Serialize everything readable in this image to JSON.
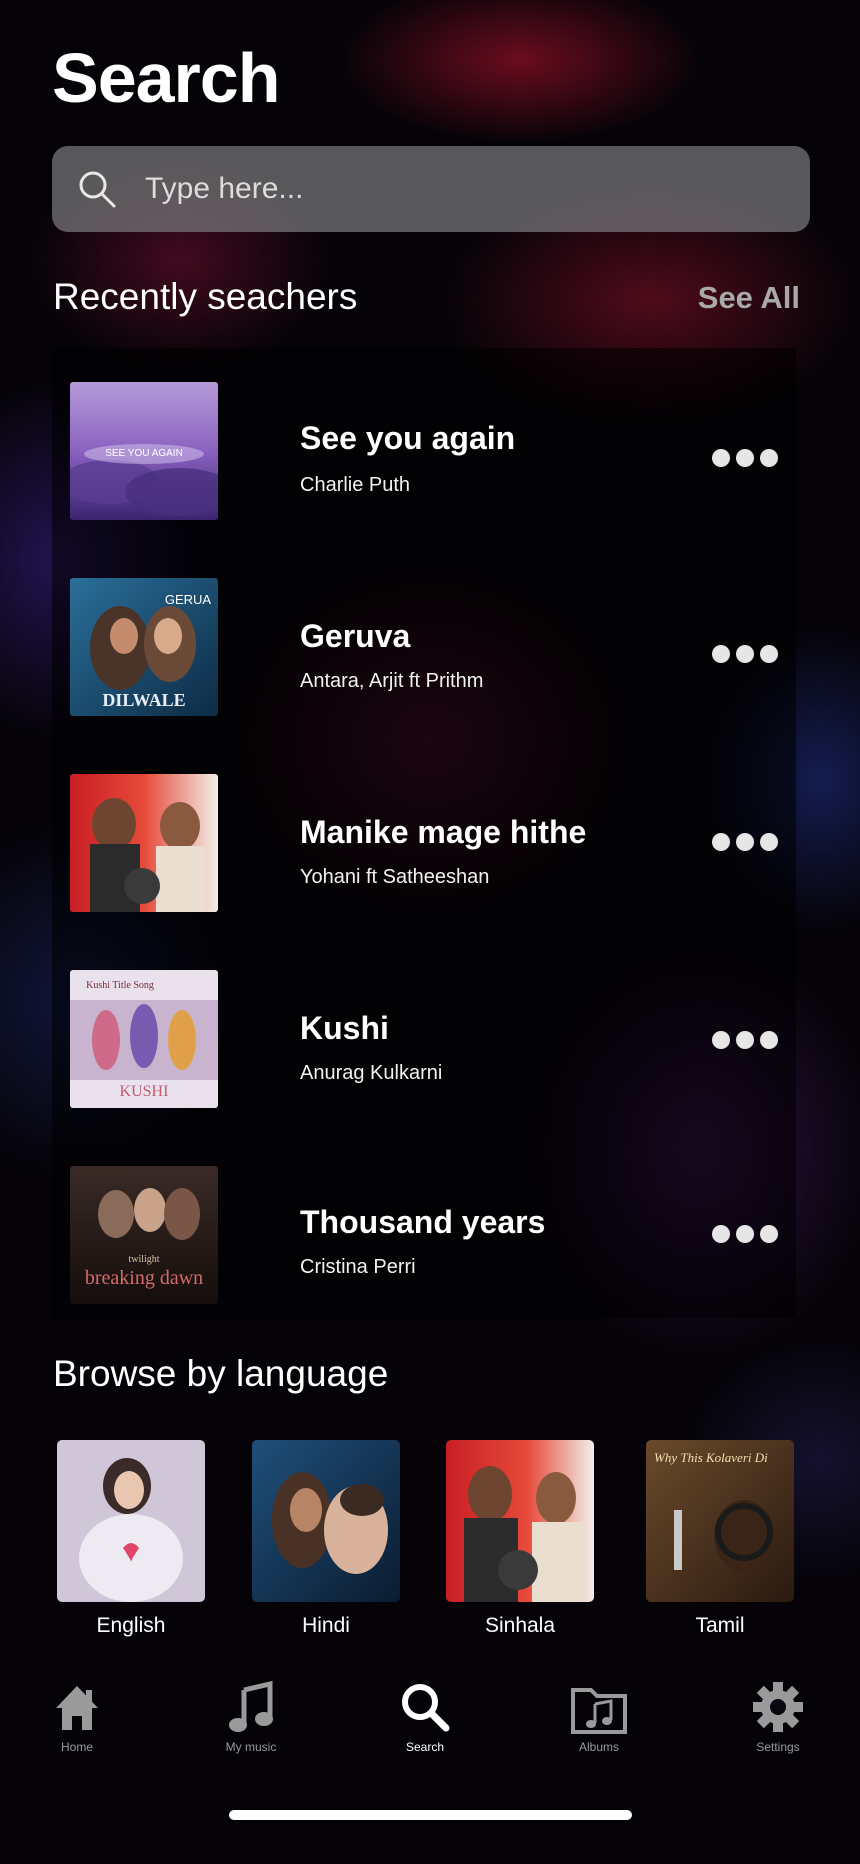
{
  "header": {
    "title": "Search"
  },
  "search": {
    "placeholder": "Type here..."
  },
  "recent": {
    "heading": "Recently seachers",
    "see_all": "See All",
    "items": [
      {
        "title": "See you again",
        "artist": "Charlie Puth",
        "cover_text": "SEE YOU AGAIN"
      },
      {
        "title": "Geruva",
        "artist": "Antara,  Arjit ft Prithm",
        "cover_text_1": "GERUA",
        "cover_text_2": "DILWALE"
      },
      {
        "title": "Manike mage hithe",
        "artist": "Yohani ft Satheeshan"
      },
      {
        "title": "Kushi",
        "artist": "Anurag Kulkarni",
        "cover_text_1": "Kushi Title Song",
        "cover_text_2": "KUSHI"
      },
      {
        "title": "Thousand years",
        "artist": "Cristina Perri",
        "cover_text_1": "breaking dawn",
        "cover_text_2": "twilight"
      }
    ]
  },
  "browse": {
    "heading": "Browse by language",
    "languages": [
      {
        "label": "English"
      },
      {
        "label": "Hindi"
      },
      {
        "label": "Sinhala"
      },
      {
        "label": "Tamil",
        "cover_text": "Why This Kolaveri Di"
      }
    ]
  },
  "tabbar": {
    "tabs": [
      {
        "label": "Home"
      },
      {
        "label": "My music"
      },
      {
        "label": "Search"
      },
      {
        "label": "Albums"
      },
      {
        "label": "Settings"
      }
    ],
    "active": "Search"
  },
  "colors": {
    "accent": "#ffffff",
    "inactive": "#9a9a9a",
    "search_bg": "#78787c"
  }
}
